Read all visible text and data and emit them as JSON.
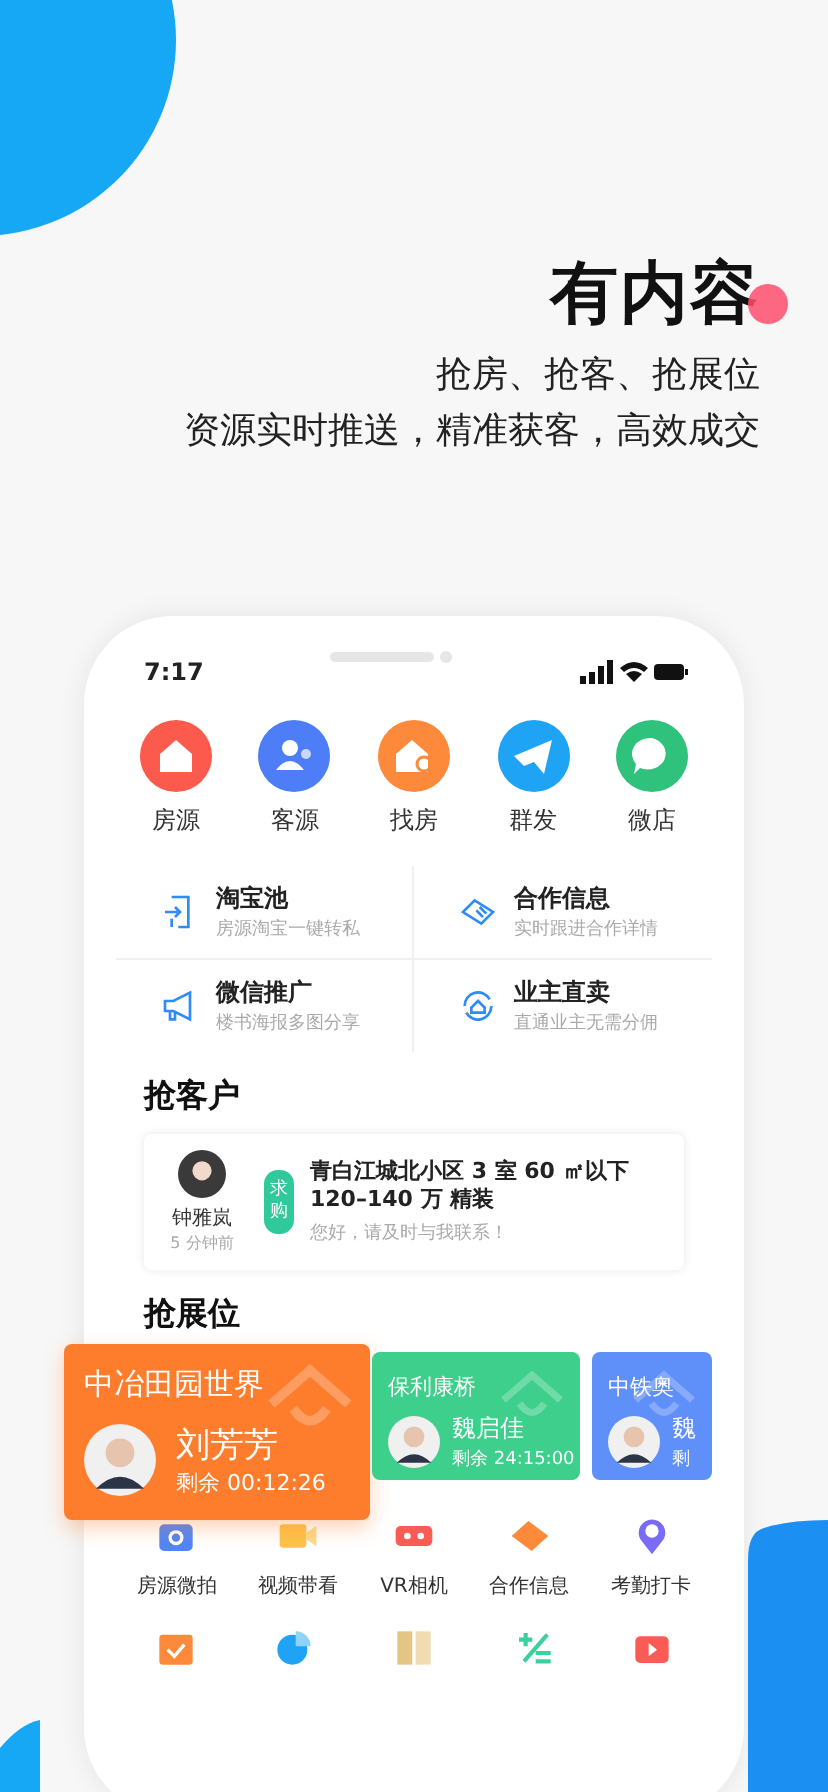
{
  "headline": {
    "title": "有内容",
    "lines": [
      "抢房、抢客、抢展位",
      "资源实时推送，精准获客，高效成交"
    ]
  },
  "status_bar": {
    "time": "7:17"
  },
  "quick_actions": [
    {
      "label": "房源",
      "color": "#fb5a4c"
    },
    {
      "label": "客源",
      "color": "#4d7ef8"
    },
    {
      "label": "找房",
      "color": "#fd8a3a"
    },
    {
      "label": "群发",
      "color": "#1ea3f5"
    },
    {
      "label": "微店",
      "color": "#2fc27d"
    }
  ],
  "features": [
    {
      "title": "淘宝池",
      "subtitle": "房源淘宝一键转私"
    },
    {
      "title": "合作信息",
      "subtitle": "实时跟进合作详情"
    },
    {
      "title": "微信推广",
      "subtitle": "楼书海报多图分享"
    },
    {
      "title": "业主直卖",
      "subtitle": "直通业主无需分佣"
    }
  ],
  "grab_customer": {
    "title": "抢客户",
    "name": "钟雅岚",
    "time": "5 分钟前",
    "tag": "求购",
    "request": "青白江城北小区 3 室 60 ㎡以下 120–140 万 精装",
    "message": "您好，请及时与我联系！"
  },
  "grab_booth": {
    "title": "抢展位",
    "cards": [
      {
        "project": "中冶田园世界",
        "name": "刘芳芳",
        "remaining": "剩余 00:12:26",
        "color": "#fe7d2c",
        "selected": true
      },
      {
        "project": "保利康桥",
        "name": "魏启佳",
        "remaining": "剩余 24:15:00",
        "color": "#3fcf8c",
        "selected": false
      },
      {
        "project": "中铁奥",
        "name": "魏",
        "remaining": "剩",
        "color": "#5f8ff8",
        "selected": false
      }
    ]
  },
  "tools": [
    {
      "label": "房源微拍"
    },
    {
      "label": "视频带看"
    },
    {
      "label": "VR相机"
    },
    {
      "label": "合作信息"
    },
    {
      "label": "考勤打卡"
    }
  ]
}
